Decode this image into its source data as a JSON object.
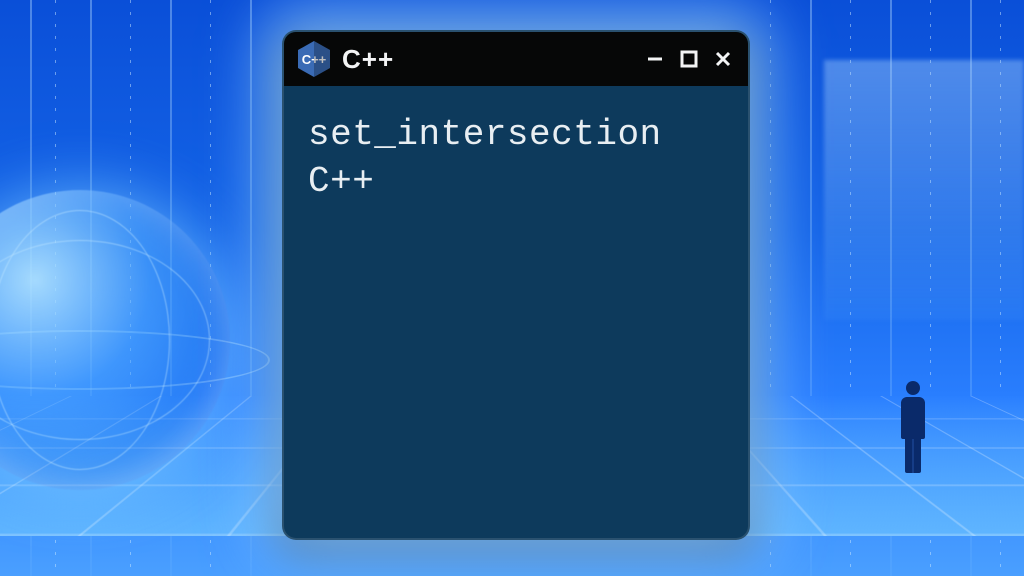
{
  "window": {
    "icon_label": "C++",
    "title": "C++",
    "controls": {
      "minimize": "minimize",
      "maximize": "maximize",
      "close": "close"
    }
  },
  "content": {
    "line1": "set_intersection",
    "line2": "C++"
  }
}
